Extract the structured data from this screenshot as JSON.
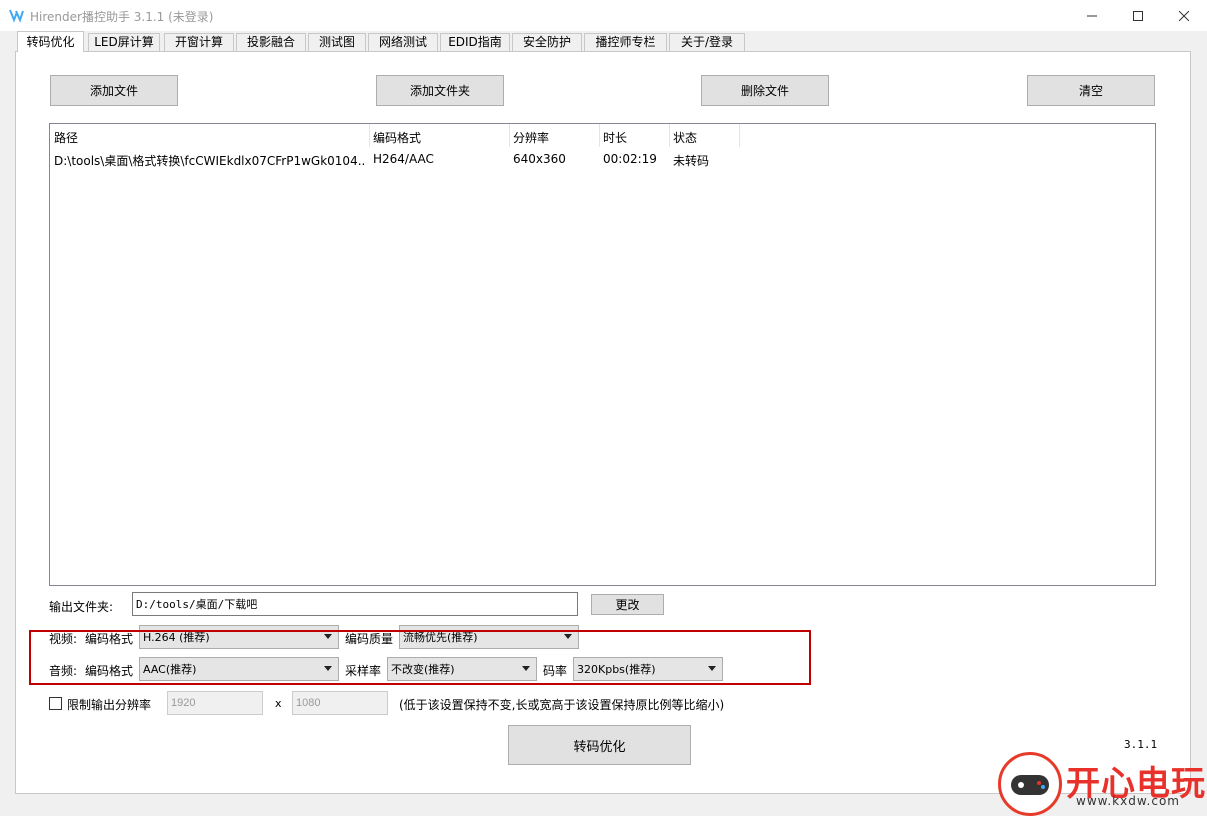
{
  "window": {
    "title": "Hirender播控助手 3.1.1 (未登录)",
    "accent_color": "#3fa9f5"
  },
  "tabs": [
    {
      "label": "转码优化",
      "active": true
    },
    {
      "label": "LED屏计算"
    },
    {
      "label": "开窗计算"
    },
    {
      "label": "投影融合"
    },
    {
      "label": "测试图"
    },
    {
      "label": "网络测试"
    },
    {
      "label": "EDID指南"
    },
    {
      "label": "安全防护"
    },
    {
      "label": "播控师专栏"
    },
    {
      "label": "关于/登录"
    }
  ],
  "toolbar": {
    "add_file": "添加文件",
    "add_folder": "添加文件夹",
    "delete_file": "删除文件",
    "clear": "清空"
  },
  "file_list": {
    "columns": [
      "路径",
      "编码格式",
      "分辨率",
      "时长",
      "状态"
    ],
    "rows": [
      {
        "path": "D:\\tools\\桌面\\格式转换\\fcCWIEkdlx07CFrP1wGk0104...",
        "codec": "H264/AAC",
        "resolution": "640x360",
        "duration": "00:02:19",
        "status": "未转码"
      }
    ]
  },
  "output": {
    "label": "输出文件夹:",
    "value": "D:/tools/桌面/下载吧",
    "change_button": "更改"
  },
  "video": {
    "label": "视频:",
    "codec_label": "编码格式",
    "codec_value": "H.264 (推荐)",
    "quality_label": "编码质量",
    "quality_value": "流畅优先(推荐)"
  },
  "audio": {
    "label": "音频:",
    "codec_label": "编码格式",
    "codec_value": "AAC(推荐)",
    "sample_label": "采样率",
    "sample_value": "不改变(推荐)",
    "bitrate_label": "码率",
    "bitrate_value": "320Kpbs(推荐)"
  },
  "resolution_limit": {
    "label": "限制输出分辨率",
    "checked": false,
    "width": "1920",
    "separator": "x",
    "height": "1080",
    "hint": "(低于该设置保持不变,长或宽高于该设置保持原比例等比缩小)"
  },
  "transcode_button": "转码优化",
  "version": "3.1.1",
  "watermark": {
    "brand": "开心电玩",
    "url": "www.kxdw.com",
    "color": "#e8312a"
  }
}
